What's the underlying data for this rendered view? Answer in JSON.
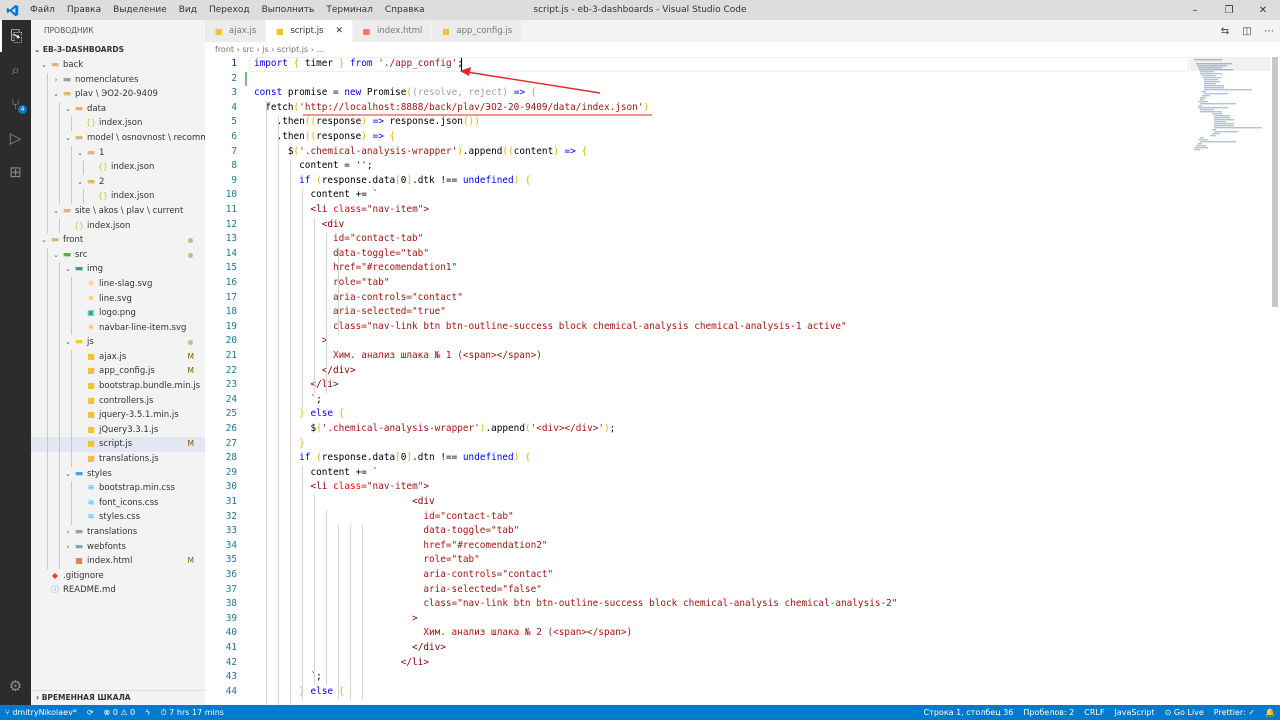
{
  "app": {
    "window_title": "script.js - eb-3-dashboards - Visual Studio Code",
    "logo": "vscode-logo",
    "menu": [
      "Файл",
      "Правка",
      "Выделение",
      "Вид",
      "Переход",
      "Выполнить",
      "Терминал",
      "Справка"
    ],
    "window_controls": {
      "minimize": "–",
      "restore": "❐",
      "close": "✕"
    }
  },
  "activity_bar": [
    {
      "name": "explorer-icon",
      "glyph": "⎘",
      "active": true
    },
    {
      "name": "search-icon",
      "glyph": "⌕",
      "active": false
    },
    {
      "name": "source-control-icon",
      "glyph": "⑂",
      "active": false,
      "badge": "4"
    },
    {
      "name": "run-debug-icon",
      "glyph": "▷",
      "active": false
    },
    {
      "name": "extensions-icon",
      "glyph": "⊞",
      "active": false
    },
    {
      "name": "manage-gear-icon",
      "glyph": "⚙",
      "active": false
    }
  ],
  "explorer": {
    "header": "ПРОВОДНИК",
    "section": "EB-3-DASHBOARDS",
    "timeline": "ВРЕМЕННАЯ ШКАЛА",
    "tree": [
      {
        "d": 0,
        "t": "folder-open",
        "label": "back"
      },
      {
        "d": 1,
        "t": "folder-closed",
        "label": "nomenclatures"
      },
      {
        "d": 1,
        "t": "folder-open",
        "label": "plav \\ ЭО2-20-9409"
      },
      {
        "d": 2,
        "t": "folder-open",
        "label": "data"
      },
      {
        "d": 3,
        "t": "json",
        "label": "index.json"
      },
      {
        "d": 2,
        "t": "folder-open",
        "label": "model \\ osnovnost \\ recomme..."
      },
      {
        "d": 3,
        "t": "folder-open",
        "label": "1"
      },
      {
        "d": 4,
        "t": "json",
        "label": "index.json"
      },
      {
        "d": 3,
        "t": "folder-open",
        "label": "2"
      },
      {
        "d": 4,
        "t": "json",
        "label": "index.json"
      },
      {
        "d": 1,
        "t": "folder-open",
        "label": "site \\ akos \\ plav \\ current"
      },
      {
        "d": 2,
        "t": "json",
        "label": "index.json"
      },
      {
        "d": 0,
        "t": "folder-open",
        "label": "front",
        "dot": true
      },
      {
        "d": 1,
        "t": "folder-open-src",
        "label": "src",
        "dot": true
      },
      {
        "d": 2,
        "t": "folder-open-img",
        "label": "img"
      },
      {
        "d": 3,
        "t": "svg",
        "label": "line-slag.svg"
      },
      {
        "d": 3,
        "t": "svg",
        "label": "line.svg"
      },
      {
        "d": 3,
        "t": "png",
        "label": "logo.png"
      },
      {
        "d": 3,
        "t": "svg",
        "label": "navbar-line-item.svg"
      },
      {
        "d": 2,
        "t": "folder-open-js",
        "label": "js",
        "dot": true
      },
      {
        "d": 3,
        "t": "js",
        "label": "ajax.js",
        "status": "M"
      },
      {
        "d": 3,
        "t": "js",
        "label": "app_config.js",
        "status": "M"
      },
      {
        "d": 3,
        "t": "js",
        "label": "bootstrap.bundle.min.js"
      },
      {
        "d": 3,
        "t": "js",
        "label": "controllers.js"
      },
      {
        "d": 3,
        "t": "js",
        "label": "jquery-3.5.1.min.js"
      },
      {
        "d": 3,
        "t": "js",
        "label": "jQuery3.3.1.js"
      },
      {
        "d": 3,
        "t": "js",
        "label": "script.js",
        "status": "M",
        "selected": true
      },
      {
        "d": 3,
        "t": "js",
        "label": "translations.js"
      },
      {
        "d": 2,
        "t": "folder-open-css",
        "label": "styles"
      },
      {
        "d": 3,
        "t": "css",
        "label": "bootstrap.min.css"
      },
      {
        "d": 3,
        "t": "css",
        "label": "font_icons.css"
      },
      {
        "d": 3,
        "t": "css",
        "label": "styles.css"
      },
      {
        "d": 2,
        "t": "folder-closed",
        "label": "translations"
      },
      {
        "d": 2,
        "t": "folder-closed",
        "label": "webfonts"
      },
      {
        "d": 2,
        "t": "html",
        "label": "index.html",
        "status": "M"
      },
      {
        "d": 0,
        "t": "git",
        "label": ".gitignore"
      },
      {
        "d": 0,
        "t": "md",
        "label": "README.md"
      }
    ]
  },
  "tabs": [
    {
      "label": "ajax.js",
      "icon": "js",
      "active": false
    },
    {
      "label": "script.js",
      "icon": "js",
      "active": true,
      "close": "✕"
    },
    {
      "label": "index.html",
      "icon": "html",
      "active": false
    },
    {
      "label": "app_config.js",
      "icon": "js",
      "active": false
    }
  ],
  "editor_tools": [
    "⇆",
    "◫",
    "⋯"
  ],
  "breadcrumb": "front › src › js › script.js › ...",
  "code": [
    [
      [
        "kw",
        "import "
      ],
      [
        "par",
        "{ "
      ],
      [
        "",
        "timer "
      ],
      [
        "par",
        "} "
      ],
      [
        "kw",
        "from "
      ],
      [
        "str",
        "'./app_config'"
      ],
      [
        "",
        ";"
      ]
    ],
    [],
    [
      [
        "kw",
        "const "
      ],
      [
        "",
        "promise = "
      ],
      [
        "kw",
        "new "
      ],
      [
        "",
        "Promise"
      ],
      [
        "par",
        "("
      ],
      [
        "dim",
        "(resolve, reject) "
      ],
      [
        "kw",
        "=> "
      ],
      [
        "par",
        "{"
      ]
    ],
    [
      [
        "",
        "  fetch"
      ],
      [
        "par",
        "("
      ],
      [
        "str",
        "'http://localhost:8888/back/plav/ЭО2-20-9409/data/index.json'"
      ],
      [
        "par",
        ")"
      ]
    ],
    [
      [
        "",
        "    .then"
      ],
      [
        "par",
        "("
      ],
      [
        "par",
        "("
      ],
      [
        "",
        "response"
      ],
      [
        "par",
        ") "
      ],
      [
        "kw",
        "=> "
      ],
      [
        "",
        "response.json"
      ],
      [
        "par",
        "()"
      ],
      [
        "par",
        ")"
      ]
    ],
    [
      [
        "",
        "    .then"
      ],
      [
        "par",
        "("
      ],
      [
        "par",
        "("
      ],
      [
        "",
        "response"
      ],
      [
        "par",
        ") "
      ],
      [
        "kw",
        "=> "
      ],
      [
        "par",
        "{"
      ]
    ],
    [
      [
        "",
        "      $"
      ],
      [
        "par",
        "("
      ],
      [
        "str",
        "'.chemical-analysis-wrapper'"
      ],
      [
        "par",
        ")"
      ],
      [
        "",
        ".append"
      ],
      [
        "par",
        "("
      ],
      [
        "par",
        "("
      ],
      [
        "",
        "content"
      ],
      [
        "par",
        ") "
      ],
      [
        "kw",
        "=> "
      ],
      [
        "par",
        "{"
      ]
    ],
    [
      [
        "",
        "        content = "
      ],
      [
        "str",
        "''"
      ],
      [
        "",
        ";"
      ]
    ],
    [
      [
        "kw",
        "        if "
      ],
      [
        "par",
        "("
      ],
      [
        "",
        "response.data"
      ],
      [
        "par",
        "["
      ],
      [
        "",
        "0"
      ],
      [
        "par",
        "]"
      ],
      [
        "",
        ".dtk !== "
      ],
      [
        "kw",
        "undefined"
      ],
      [
        "par",
        ") {"
      ]
    ],
    [
      [
        "",
        "          content += "
      ],
      [
        "str",
        "`"
      ]
    ],
    [
      [
        "str",
        "          "
      ],
      [
        "tag",
        "<li "
      ],
      [
        "att",
        "class"
      ],
      [
        "str",
        "=\"nav-item\""
      ],
      [
        "tag",
        ">"
      ]
    ],
    [
      [
        "str",
        "            "
      ],
      [
        "tag",
        "<div"
      ]
    ],
    [
      [
        "str",
        "              id=\"contact-tab\""
      ]
    ],
    [
      [
        "str",
        "              data-toggle=\"tab\""
      ]
    ],
    [
      [
        "str",
        "              href=\"#recomendation1\""
      ]
    ],
    [
      [
        "str",
        "              role=\"tab\""
      ]
    ],
    [
      [
        "str",
        "              aria-controls=\"contact\""
      ]
    ],
    [
      [
        "str",
        "              aria-selected=\"true\""
      ]
    ],
    [
      [
        "str",
        "              class=\"nav-link btn btn-outline-success block chemical-analysis chemical-analysis-1 active\""
      ]
    ],
    [
      [
        "str",
        "            "
      ],
      [
        "tag",
        ">"
      ]
    ],
    [
      [
        "str",
        "              Хим. анализ шлака № 1 (<span></span>)"
      ]
    ],
    [
      [
        "str",
        "            "
      ],
      [
        "tag",
        "</div>"
      ]
    ],
    [
      [
        "str",
        "          "
      ],
      [
        "tag",
        "</li>"
      ]
    ],
    [
      [
        "str",
        "          `"
      ],
      [
        "",
        ";"
      ]
    ],
    [
      [
        "par",
        "        } "
      ],
      [
        "kw",
        "else "
      ],
      [
        "par",
        "{"
      ]
    ],
    [
      [
        "",
        "          $"
      ],
      [
        "par",
        "("
      ],
      [
        "str",
        "'.chemical-analysis-wrapper'"
      ],
      [
        "par",
        ")"
      ],
      [
        "",
        ".append"
      ],
      [
        "par",
        "("
      ],
      [
        "str",
        "'<div></div>'"
      ],
      [
        "par",
        ")"
      ],
      [
        "",
        ";"
      ]
    ],
    [
      [
        "par",
        "        }"
      ]
    ],
    [
      [
        "kw",
        "        if "
      ],
      [
        "par",
        "("
      ],
      [
        "",
        "response.data"
      ],
      [
        "par",
        "["
      ],
      [
        "",
        "0"
      ],
      [
        "par",
        "]"
      ],
      [
        "",
        ".dtn !== "
      ],
      [
        "kw",
        "undefined"
      ],
      [
        "par",
        ") {"
      ]
    ],
    [
      [
        "",
        "          content += "
      ],
      [
        "str",
        "`"
      ]
    ],
    [
      [
        "str",
        "          "
      ],
      [
        "tag",
        "<li "
      ],
      [
        "att",
        "class"
      ],
      [
        "str",
        "=\"nav-item\""
      ],
      [
        "tag",
        ">"
      ]
    ],
    [
      [
        "str",
        "                            "
      ],
      [
        "tag",
        "<div"
      ]
    ],
    [
      [
        "str",
        "                              id=\"contact-tab\""
      ]
    ],
    [
      [
        "str",
        "                              data-toggle=\"tab\""
      ]
    ],
    [
      [
        "str",
        "                              href=\"#recomendation2\""
      ]
    ],
    [
      [
        "str",
        "                              role=\"tab\""
      ]
    ],
    [
      [
        "str",
        "                              aria-controls=\"contact\""
      ]
    ],
    [
      [
        "str",
        "                              aria-selected=\"false\""
      ]
    ],
    [
      [
        "str",
        "                              class=\"nav-link btn btn-outline-success block chemical-analysis chemical-analysis-2\""
      ]
    ],
    [
      [
        "str",
        "                            "
      ],
      [
        "tag",
        ">"
      ]
    ],
    [
      [
        "str",
        "                              Хим. анализ шлака № 2 (<span></span>)"
      ]
    ],
    [
      [
        "str",
        "                            "
      ],
      [
        "tag",
        "</div>"
      ]
    ],
    [
      [
        "str",
        "                          "
      ],
      [
        "tag",
        "</li>"
      ]
    ],
    [
      [
        "str",
        "          `"
      ],
      [
        "",
        ";"
      ]
    ],
    [
      [
        "par",
        "        } "
      ],
      [
        "kw",
        "else "
      ],
      [
        "par",
        "{"
      ]
    ]
  ],
  "status_bar": {
    "left": [
      {
        "name": "git-branch",
        "text": "⑂ dmitryNikolaev*"
      },
      {
        "name": "sync",
        "text": "⟳"
      },
      {
        "name": "problems",
        "text": "⊗ 0 ⚠ 0"
      },
      {
        "name": "lightning",
        "text": "ϟ"
      },
      {
        "name": "time-tracker",
        "text": "⏱ 7 hrs 17 mins"
      }
    ],
    "right": [
      {
        "name": "cursor-position",
        "text": "Строка 1, столбец 36"
      },
      {
        "name": "indentation",
        "text": "Пробелов: 2"
      },
      {
        "name": "eol",
        "text": "CRLF"
      },
      {
        "name": "language-mode",
        "text": "JavaScript"
      },
      {
        "name": "go-live",
        "text": "⊙ Go Live"
      },
      {
        "name": "prettier",
        "text": "Prettier: ✓"
      },
      {
        "name": "notifications",
        "text": "🔔"
      }
    ]
  }
}
